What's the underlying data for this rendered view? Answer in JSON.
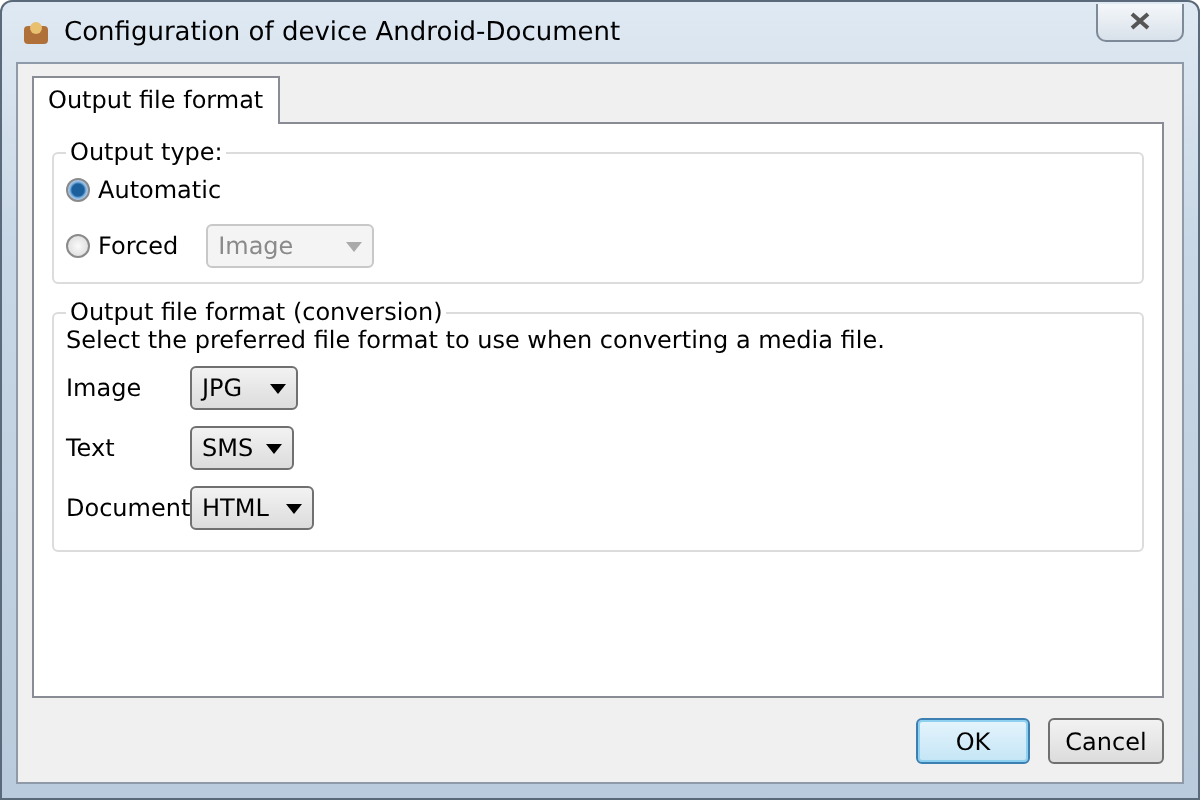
{
  "window": {
    "title": "Configuration of device Android-Document"
  },
  "tabs": [
    {
      "label": "Output file format",
      "selected": true
    }
  ],
  "output_type": {
    "legend": "Output type:",
    "options": [
      {
        "label": "Automatic",
        "selected": true
      },
      {
        "label": "Forced",
        "selected": false,
        "dropdown": {
          "value": "Image",
          "disabled": true
        }
      }
    ]
  },
  "conversion": {
    "legend": "Output file format (conversion)",
    "description": "Select the preferred file format to use when converting a media file.",
    "rows": [
      {
        "label": "Image",
        "value": "JPG"
      },
      {
        "label": "Text",
        "value": "SMS"
      },
      {
        "label": "Document",
        "value": "HTML"
      }
    ]
  },
  "buttons": [
    {
      "label": "OK",
      "default": true
    },
    {
      "label": "Cancel",
      "default": false
    }
  ]
}
